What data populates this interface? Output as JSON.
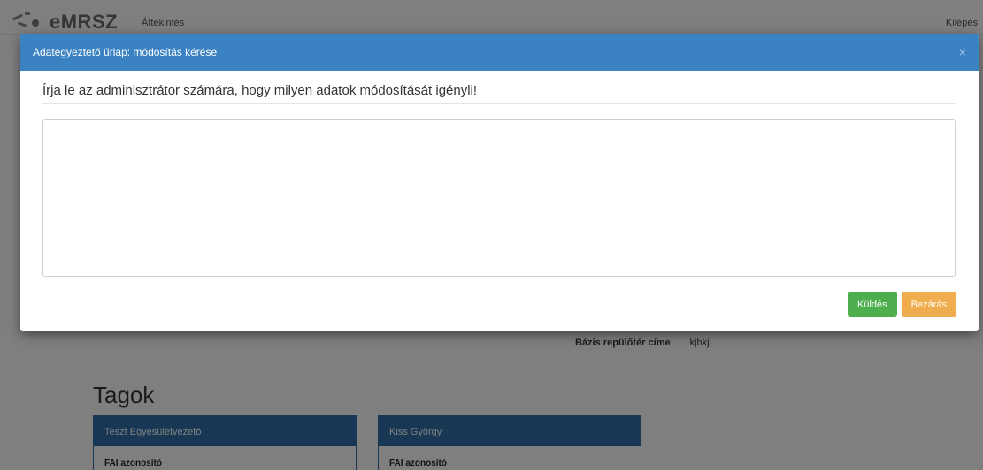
{
  "navbar": {
    "brand": "eMRSZ",
    "overview_link": "Áttekintés",
    "logout_link": "Kilépés"
  },
  "content": {
    "base_airport_label": "Bázis repülőtér címe",
    "base_airport_value": "kjhkj",
    "members_title": "Tagok",
    "members": [
      {
        "name": "Teszt Egyesületvezető",
        "field_label": "FAI azonosító"
      },
      {
        "name": "Kiss György",
        "field_label": "FAI azonosító"
      }
    ]
  },
  "modal": {
    "title": "Adategyeztető űrlap: módosítás kérése",
    "close_symbol": "×",
    "prompt": "Írja le az adminisztrátor számára, hogy milyen adatok módosítását igényli!",
    "message_value": "",
    "send_label": "Küldés",
    "close_label": "Bezárás"
  },
  "colors": {
    "header": "#3b82c2",
    "send": "#4cae4c",
    "close": "#f0ad4e",
    "card_header": "#2f6ea8"
  }
}
